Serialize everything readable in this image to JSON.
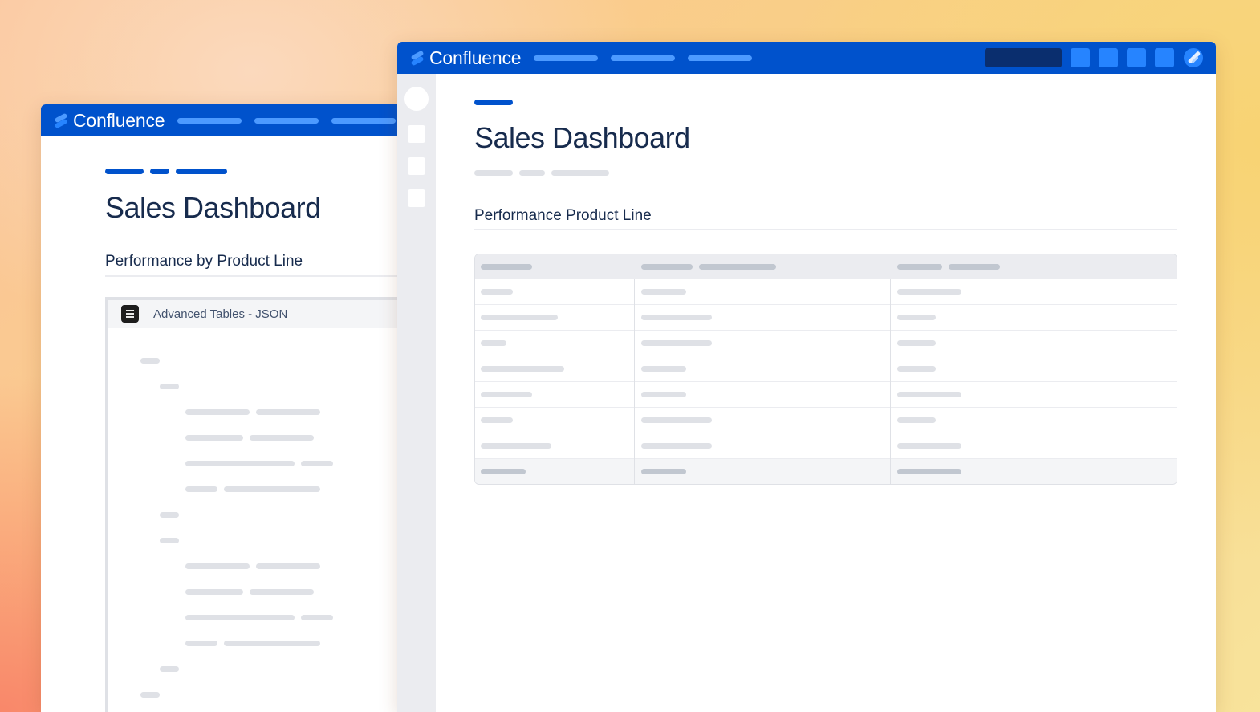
{
  "colors": {
    "topbar": "#0052cc",
    "accent_light": "#4c9aff",
    "placeholder": "#dfe1e6",
    "text": "#172b4d"
  },
  "back_window": {
    "brand": "Confluence",
    "page_title": "Sales Dashboard",
    "section_heading": "Performance by Product Line",
    "macro": {
      "icon": "table-list-icon",
      "title": "Advanced Tables - JSON"
    }
  },
  "front_window": {
    "brand": "Confluence",
    "page_title": "Sales Dashboard",
    "section_heading": "Performance Product Line",
    "topbar_icons": [
      "search-box",
      "app-icon",
      "app-icon",
      "app-icon",
      "app-icon",
      "avatar-icon"
    ],
    "sidebar_icons": [
      "space-avatar-icon",
      "sidebar-icon",
      "sidebar-icon",
      "sidebar-icon"
    ],
    "table": {
      "columns": 3,
      "body_rows": 7,
      "has_total_row": true
    }
  }
}
